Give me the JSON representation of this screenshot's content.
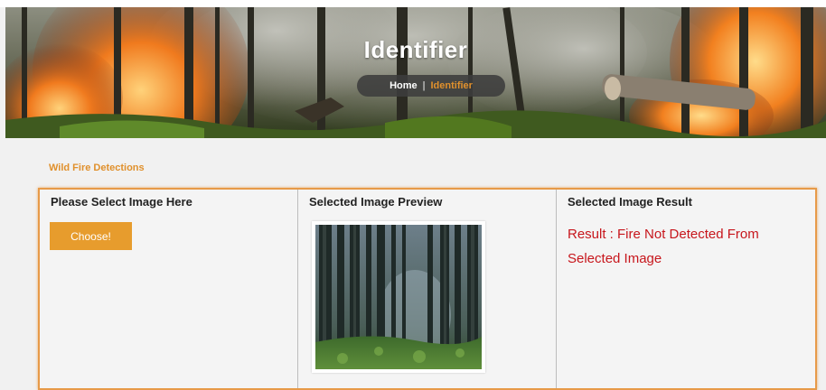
{
  "hero": {
    "title": "Identifier",
    "breadcrumb": {
      "home": "Home",
      "separator": "|",
      "current": "Identifier"
    }
  },
  "section": {
    "label": "Wild Fire Detections"
  },
  "panel": {
    "columns": [
      {
        "heading": "Please Select Image Here"
      },
      {
        "heading": "Selected Image Preview"
      },
      {
        "heading": "Selected Image Result"
      }
    ],
    "choose_button": "Choose!",
    "result_text": "Result : Fire Not Detected From Selected Image"
  },
  "colors": {
    "accent": "#e79c2d",
    "result": "#c7161c",
    "border": "#e79a48"
  }
}
